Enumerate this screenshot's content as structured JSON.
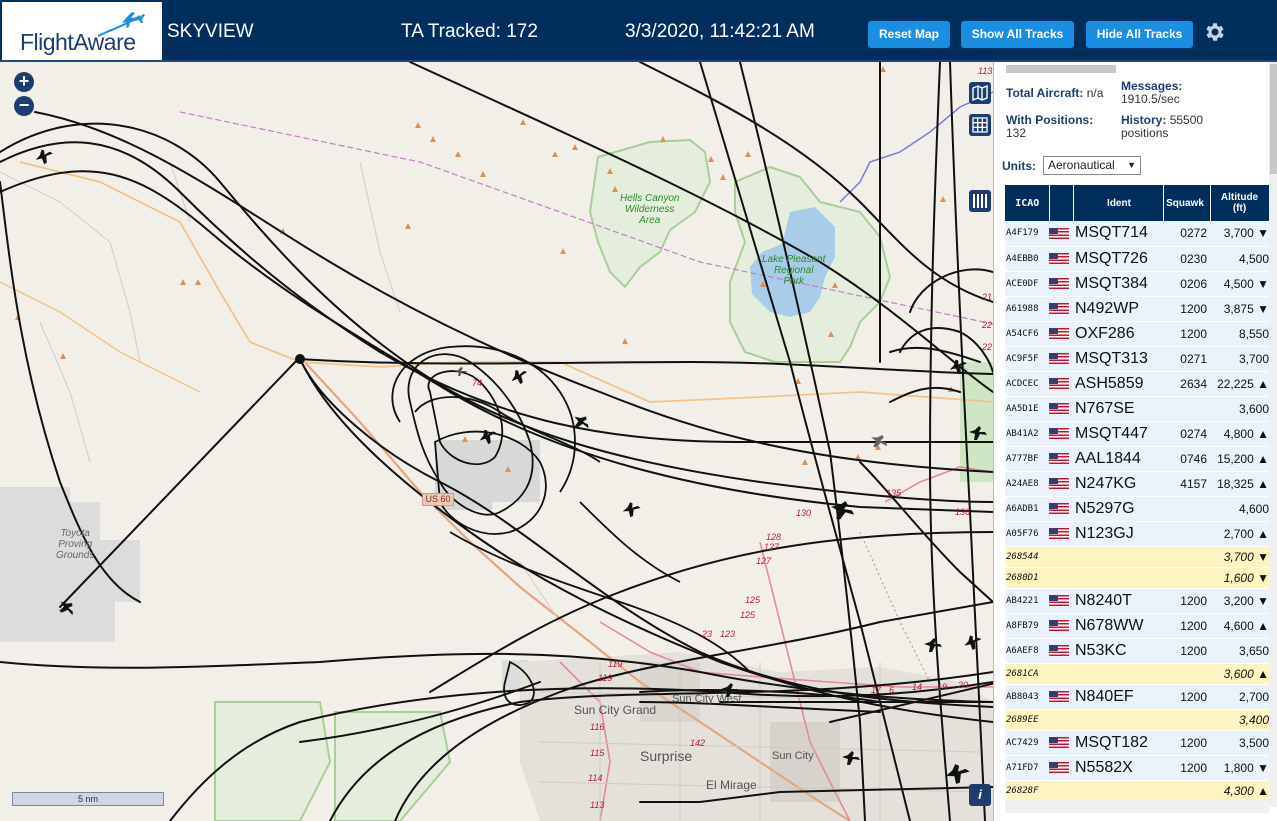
{
  "header": {
    "logo_text": "FlightAware",
    "site_name": "SKYVIEW",
    "ta_tracked": "TA Tracked: 172",
    "clock": "3/3/2020, 11:42:21 AM",
    "buttons": {
      "reset": "Reset Map",
      "show_all": "Show All Tracks",
      "hide_all": "Hide All Tracks"
    },
    "settings_icon": "gear-icon"
  },
  "map": {
    "zoom_in": "+",
    "zoom_out": "−",
    "scale": "5 nm",
    "info": "i",
    "places": {
      "toyota_1": "Toyota",
      "toyota_2": "Proving",
      "toyota_3": "Grounds",
      "hells_1": "Hells Canyon",
      "hells_2": "Wilderness",
      "hells_3": "Area",
      "lake_1": "Lake Pleasant",
      "lake_2": "Regional",
      "lake_3": "Park",
      "sun_city_grand": "Sun City Grand",
      "sun_city_west": "Sun City West",
      "surprise": "Surprise",
      "sun_city": "Sun City",
      "el_mirage": "El Mirage",
      "us60": "US 60"
    },
    "road_numbers": [
      "74",
      "135",
      "130",
      "128",
      "127",
      "127",
      "136",
      "125",
      "125",
      "23",
      "123",
      "119",
      "119",
      "116",
      "115",
      "114",
      "113",
      "142",
      "17",
      "6",
      "14",
      "19",
      "20",
      "22",
      "22",
      "21",
      "113"
    ]
  },
  "panel": {
    "total_label": "Total Aircraft:",
    "total_value": "n/a",
    "pos_label": "With Positions:",
    "pos_value": "132",
    "msg_label": "Messages:",
    "msg_value": "1910.5/sec",
    "hist_label": "History:",
    "hist_value": "55500",
    "hist_unit": "positions",
    "units_label": "Units:",
    "units_value": "Aeronautical",
    "columns": {
      "icao": "ICAO",
      "ident": "Ident",
      "squawk": "Squawk",
      "alt1": "Altitude",
      "alt2": "(ft)"
    },
    "rows": [
      {
        "icao": "A4F179",
        "ident": "MSQT714",
        "squawk": "0272",
        "alt": "3,700 ▼",
        "mlat": false
      },
      {
        "icao": "A4EBB0",
        "ident": "MSQT726",
        "squawk": "0230",
        "alt": "4,500",
        "mlat": false
      },
      {
        "icao": "ACE0DF",
        "ident": "MSQT384",
        "squawk": "0206",
        "alt": "4,500 ▼",
        "mlat": false
      },
      {
        "icao": "A61988",
        "ident": "N492WP",
        "squawk": "1200",
        "alt": "3,875 ▼",
        "mlat": false
      },
      {
        "icao": "A54CF6",
        "ident": "OXF286",
        "squawk": "1200",
        "alt": "8,550",
        "mlat": false
      },
      {
        "icao": "AC9F5F",
        "ident": "MSQT313",
        "squawk": "0271",
        "alt": "3,700",
        "mlat": false
      },
      {
        "icao": "ACDCEC",
        "ident": "ASH5859",
        "squawk": "2634",
        "alt": "22,225 ▲",
        "mlat": false
      },
      {
        "icao": "AA5D1E",
        "ident": "N767SE",
        "squawk": "",
        "alt": "3,600",
        "mlat": false
      },
      {
        "icao": "AB41A2",
        "ident": "MSQT447",
        "squawk": "0274",
        "alt": "4,800 ▲",
        "mlat": false
      },
      {
        "icao": "A777BF",
        "ident": "AAL1844",
        "squawk": "0746",
        "alt": "15,200 ▲",
        "mlat": false
      },
      {
        "icao": "A24AE8",
        "ident": "N247KG",
        "squawk": "4157",
        "alt": "18,325 ▲",
        "mlat": false
      },
      {
        "icao": "A6ADB1",
        "ident": "N5297G",
        "squawk": "",
        "alt": "4,600",
        "mlat": false
      },
      {
        "icao": "A05F76",
        "ident": "N123GJ",
        "squawk": "",
        "alt": "2,700 ▲",
        "mlat": false
      },
      {
        "icao": "268544",
        "ident": "",
        "squawk": "",
        "alt": "3,700 ▼",
        "mlat": true
      },
      {
        "icao": "2680D1",
        "ident": "",
        "squawk": "",
        "alt": "1,600 ▼",
        "mlat": true
      },
      {
        "icao": "AB4221",
        "ident": "N8240T",
        "squawk": "1200",
        "alt": "3,200 ▼",
        "mlat": false
      },
      {
        "icao": "A8FB79",
        "ident": "N678WW",
        "squawk": "1200",
        "alt": "4,600 ▲",
        "mlat": false
      },
      {
        "icao": "A6AEF8",
        "ident": "N53KC",
        "squawk": "1200",
        "alt": "3,650",
        "mlat": false
      },
      {
        "icao": "2681CA",
        "ident": "",
        "squawk": "",
        "alt": "3,600 ▲",
        "mlat": true
      },
      {
        "icao": "AB8043",
        "ident": "N840EF",
        "squawk": "1200",
        "alt": "2,700",
        "mlat": false
      },
      {
        "icao": "2689EE",
        "ident": "",
        "squawk": "",
        "alt": "3,400",
        "mlat": true
      },
      {
        "icao": "AC7429",
        "ident": "MSQT182",
        "squawk": "1200",
        "alt": "3,500",
        "mlat": false
      },
      {
        "icao": "A71FD7",
        "ident": "N5582X",
        "squawk": "1200",
        "alt": "1,800 ▼",
        "mlat": false
      },
      {
        "icao": "26828F",
        "ident": "",
        "squawk": "",
        "alt": "4,300 ▲",
        "mlat": true
      }
    ]
  },
  "colors": {
    "header_bg": "#002f5d",
    "button_bg": "#1a8ee0",
    "row_bg": "#e8f3fb",
    "mlat_row_bg": "#fdf4c2"
  }
}
